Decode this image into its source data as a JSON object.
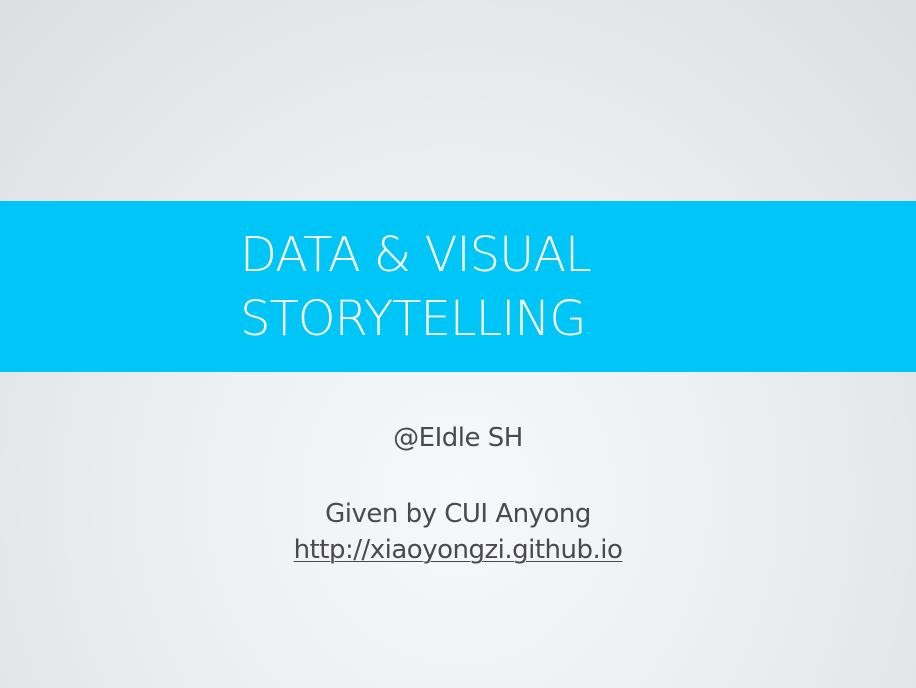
{
  "slide": {
    "title_line_1": "DATA & VISUAL",
    "title_line_2": "STORYTELLING",
    "handle": "@EIdle SH",
    "presenter": "Given by CUI Anyong",
    "link_text": "http://xiaoyongzi.github.io",
    "accent_color": "#00c6f7"
  }
}
